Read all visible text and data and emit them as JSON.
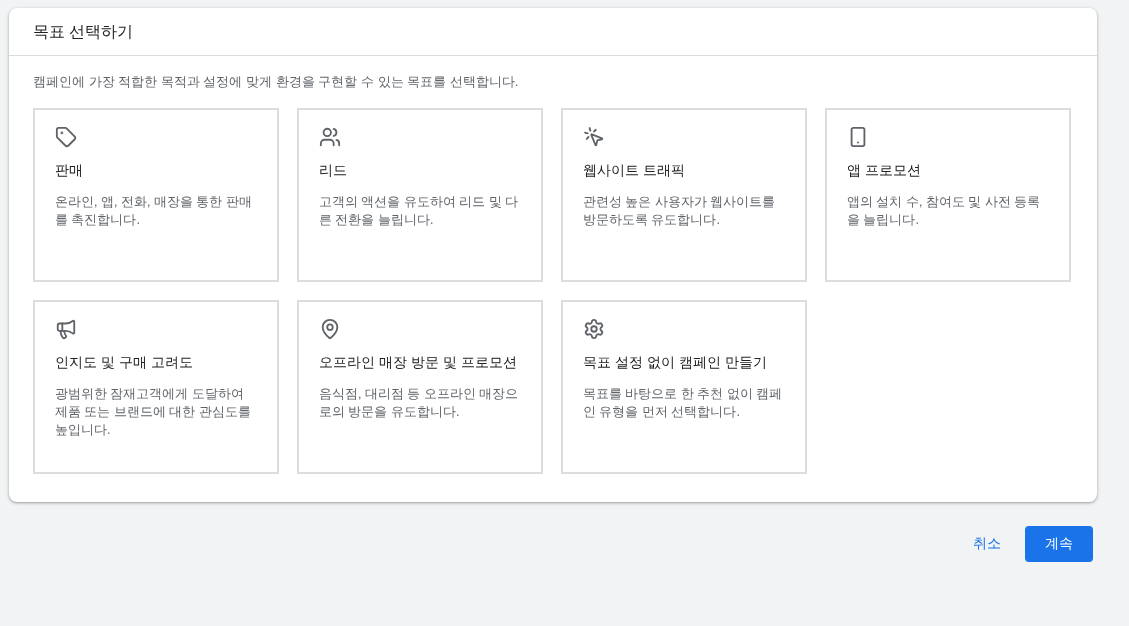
{
  "panel": {
    "title": "목표 선택하기",
    "description": "캠페인에 가장 적합한 목적과 설정에 맞게 환경을 구현할 수 있는 목표를 선택합니다."
  },
  "goals": [
    {
      "kind": "tag",
      "title": "판매",
      "description": "온라인, 앱, 전화, 매장을 통한 판매를 촉진합니다.",
      "selected": false
    },
    {
      "kind": "people",
      "title": "리드",
      "description": "고객의 액션을 유도하여 리드 및 다른 전환을 늘립니다.",
      "selected": false
    },
    {
      "kind": "click",
      "title": "웹사이트 트래픽",
      "description": "관련성 높은 사용자가 웹사이트를 방문하도록 유도합니다.",
      "selected": false
    },
    {
      "kind": "phone",
      "title": "앱 프로모션",
      "description": "앱의 설치 수, 참여도 및 사전 등록을 늘립니다.",
      "selected": false
    },
    {
      "kind": "megaphone",
      "title": "인지도 및 구매 고려도",
      "description": "광범위한 잠재고객에게 도달하여 제품 또는 브랜드에 대한 관심도를 높입니다.",
      "selected": false
    },
    {
      "kind": "pin",
      "title": "오프라인 매장 방문 및 프로모션",
      "description": "음식점, 대리점 등 오프라인 매장으로의 방문을 유도합니다.",
      "selected": false
    },
    {
      "kind": "gear",
      "title": "목표 설정 없이 캠페인 만들기",
      "description": "목표를 바탕으로 한 추천 없이 캠페인 유형을 먼저 선택합니다.",
      "selected": false
    }
  ],
  "buttons": {
    "cancel": "취소",
    "continue": "계속"
  }
}
